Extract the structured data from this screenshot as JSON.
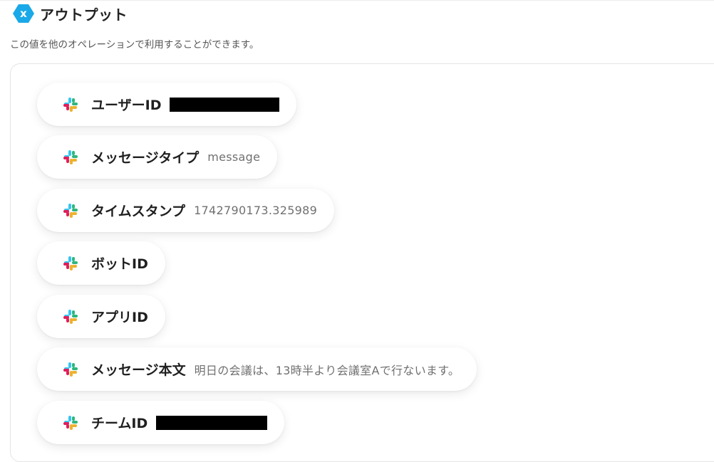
{
  "header": {
    "title": "アウトプット",
    "description": "この値を他のオペレーションで利用することができます。",
    "logo_letter": "x",
    "logo_color": "#1aa9e8"
  },
  "slack_colors": {
    "blue": "#36c5f0",
    "green": "#2eb67d",
    "yellow": "#ecb22e",
    "red": "#e01e5a"
  },
  "outputs": [
    {
      "label": "ユーザーID",
      "value": "",
      "redacted": true,
      "icon": "slack-icon"
    },
    {
      "label": "メッセージタイプ",
      "value": "message",
      "redacted": false,
      "icon": "slack-icon"
    },
    {
      "label": "タイムスタンプ",
      "value": "1742790173.325989",
      "redacted": false,
      "icon": "slack-icon"
    },
    {
      "label": "ボットID",
      "value": "",
      "redacted": false,
      "icon": "slack-icon"
    },
    {
      "label": "アプリID",
      "value": "",
      "redacted": false,
      "icon": "slack-icon"
    },
    {
      "label": "メッセージ本文",
      "value": "明日の会議は、13時半より会議室Aで行ないます。",
      "redacted": false,
      "icon": "slack-icon"
    },
    {
      "label": "チームID",
      "value": "",
      "redacted": true,
      "icon": "slack-icon"
    }
  ]
}
